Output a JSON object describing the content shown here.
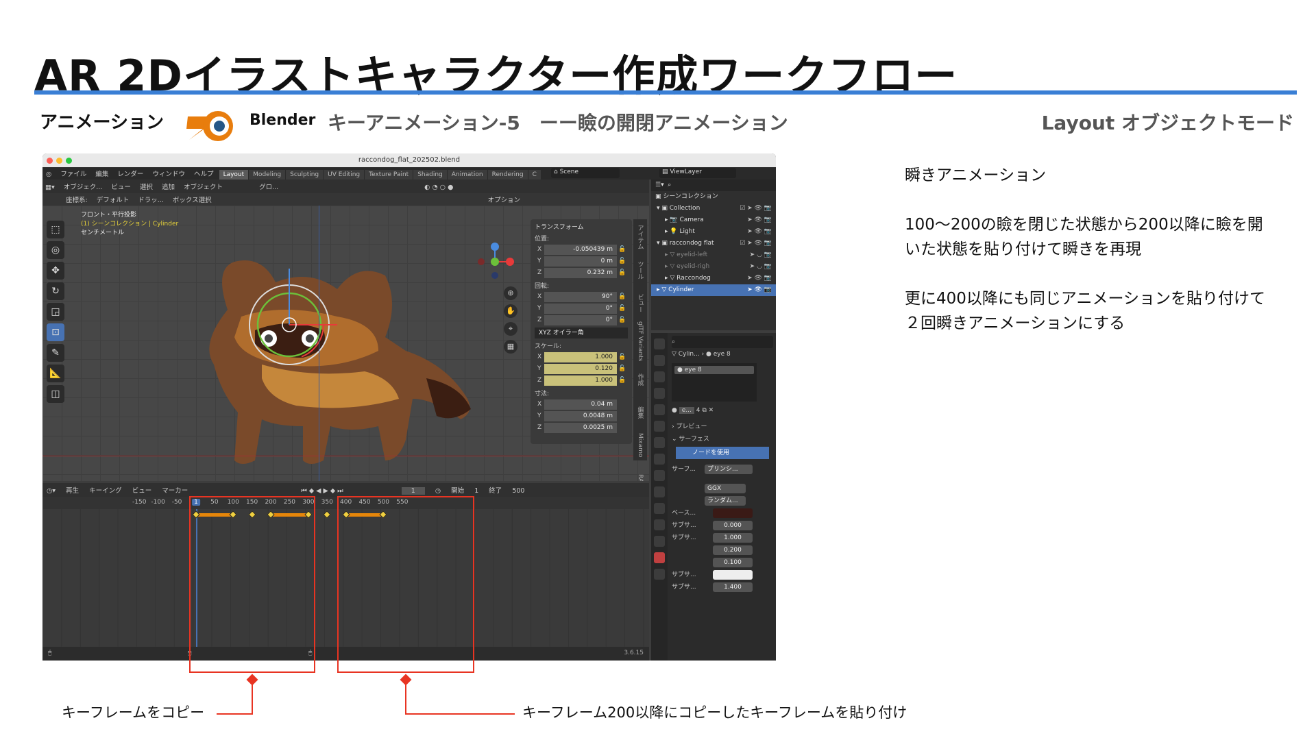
{
  "slide": {
    "title": "AR 2Dイラストキャラクター作成ワークフロー",
    "section": "アニメーション",
    "app": "Blender",
    "topic": "キーアニメーション-5　ーー瞼の開閉アニメーション",
    "mode": "Layout オブジェクトモード"
  },
  "colors": {
    "title_rule": "#3a7fd5",
    "annotation": "#e83422",
    "keyframe_bar": "#e6860a",
    "selection": "#4772b3"
  },
  "blender": {
    "filename": "raccondog_flat_202502.blend",
    "menu": [
      "ファイル",
      "編集",
      "レンダー",
      "ウィンドウ",
      "ヘルプ"
    ],
    "workspaces": [
      "Layout",
      "Modeling",
      "Sculpting",
      "UV Editing",
      "Texture Paint",
      "Shading",
      "Animation",
      "Rendering",
      "C"
    ],
    "scene": "Scene",
    "view_layer": "ViewLayer",
    "viewport": {
      "header": [
        "オブジェク...",
        "ビュー",
        "選択",
        "追加",
        "オブジェクト"
      ],
      "header2": [
        "座標系:",
        "デフォルト",
        "ドラッ...",
        "ボックス選択"
      ],
      "transform_orient": "グロ...",
      "options": "オプション",
      "view_name": "フロント・平行投影",
      "collection_line": "(1) シーンコレクション | Cylinder",
      "unit": "センチメートル"
    },
    "transform": {
      "header": "トランスフォーム",
      "location_label": "位置:",
      "location": [
        {
          "ax": "X",
          "v": "-0.050439 m"
        },
        {
          "ax": "Y",
          "v": "0 m"
        },
        {
          "ax": "Z",
          "v": "0.232 m"
        }
      ],
      "rotation_label": "回転:",
      "rotation": [
        {
          "ax": "X",
          "v": "90°"
        },
        {
          "ax": "Y",
          "v": "0°"
        },
        {
          "ax": "Z",
          "v": "0°"
        }
      ],
      "rotation_mode": "XYZ オイラー角",
      "scale_label": "スケール:",
      "scale": [
        {
          "ax": "X",
          "v": "1.000"
        },
        {
          "ax": "Y",
          "v": "0.120"
        },
        {
          "ax": "Z",
          "v": "1.000"
        }
      ],
      "dims_label": "寸法:",
      "dims": [
        {
          "ax": "X",
          "v": "0.04 m"
        },
        {
          "ax": "Y",
          "v": "0.0048 m"
        },
        {
          "ax": "Z",
          "v": "0.0025 m"
        }
      ]
    },
    "side_tabs": [
      "アイテム",
      "ツール",
      "ビュー",
      "glTF Variants",
      "作成",
      "編集",
      "Mixamo",
      "RA"
    ],
    "outliner": {
      "title": "シーンコレクション",
      "items": [
        "Collection",
        "Camera",
        "Light",
        "raccondog flat",
        "eyelid-left",
        "eyelid-righ",
        "Raccondog",
        "Cylinder"
      ]
    },
    "properties": {
      "breadcrumb_obj": "Cylin...",
      "breadcrumb_mat": "eye 8",
      "material_slot": "eye 8",
      "mat_field": "e...",
      "users": "4",
      "preview": "プレビュー",
      "surface": "サーフェス",
      "use_nodes": "ノードを使用",
      "surface_label": "サーフ...",
      "surface_value": "プリンシ...",
      "ggx": "GGX",
      "random": "ランダム...",
      "base": "ベース...",
      "sub1": "サブサ...",
      "sub1_val": "0.000",
      "sub2": "サブサ...",
      "sub2_vals": [
        "1.000",
        "0.200",
        "0.100"
      ],
      "sub3": "サブサ...",
      "sub4": "サブサ...",
      "sub4_val": "1.400"
    },
    "timeline": {
      "header": [
        "再生",
        "キーイング",
        "ビュー",
        "マーカー"
      ],
      "current": "1",
      "start_label": "開始",
      "start": "1",
      "end_label": "終了",
      "end": "500",
      "ticks": [
        "-150",
        "-100",
        "-50",
        "1",
        "50",
        "100",
        "150",
        "200",
        "250",
        "300",
        "350",
        "400",
        "450",
        "500",
        "550"
      ],
      "keyframes": [
        1,
        100,
        150,
        200,
        300,
        350,
        400,
        500
      ],
      "holds": [
        [
          1,
          100
        ],
        [
          200,
          300
        ],
        [
          400,
          500
        ]
      ]
    },
    "version": "3.6.15"
  },
  "annotations": {
    "left": "キーフレームをコピー",
    "right": "キーフレーム200以降にコピーしたキーフレームを貼り付け"
  },
  "right_text": {
    "heading": "瞬きアニメーション",
    "p1a": "100〜200の瞼を閉じた状態から200以降に瞼を開",
    "p1b": "いた状態を貼り付けて瞬きを再現",
    "p2a": "更に400以降にも同じアニメーションを貼り付けて",
    "p2b": "２回瞬きアニメーションにする"
  }
}
